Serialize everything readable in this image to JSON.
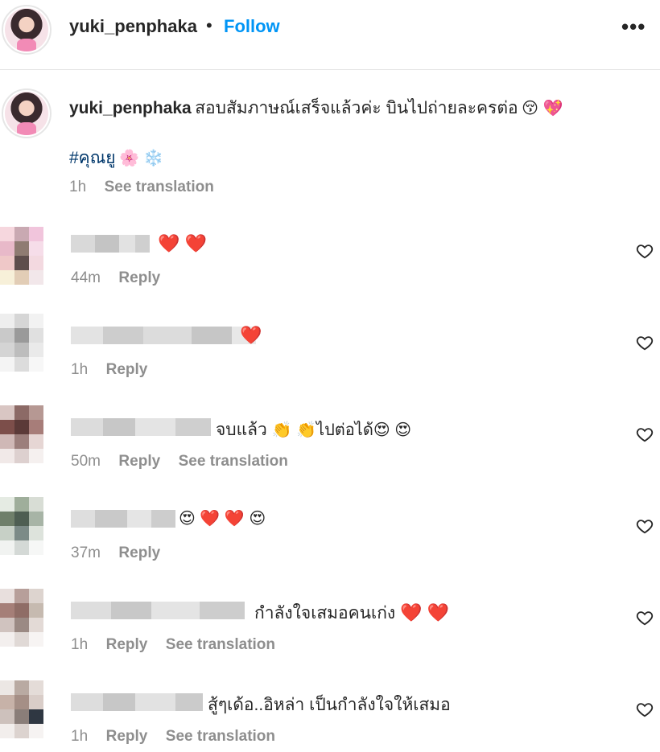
{
  "header": {
    "username": "yuki_penphaka",
    "separator": "•",
    "follow_label": "Follow",
    "more_icon": "•••"
  },
  "caption": {
    "username": "yuki_penphaka",
    "text": "สอบสัมภาษณ์เสร็จแล้วค่ะ บินไปถ่ายละครต่อ",
    "emojis": "😚 💖",
    "hashtag": "#คุณยู",
    "hashtag_emojis": "🌸 ❄️",
    "time": "1h",
    "see_translation": "See translation"
  },
  "comments": [
    {
      "text": "",
      "suffix": "❤️ ❤️",
      "time": "44m",
      "reply": "Reply",
      "see_translation": ""
    },
    {
      "text": "",
      "suffix": "❤️",
      "time": "1h",
      "reply": "Reply",
      "see_translation": ""
    },
    {
      "text": "จบแล้ว",
      "suffix": "👏 👏ไปต่อได้😍 😍",
      "time": "50m",
      "reply": "Reply",
      "see_translation": "See translation"
    },
    {
      "text": "",
      "suffix": "😍 ❤️ ❤️ 😍",
      "time": "37m",
      "reply": "Reply",
      "see_translation": ""
    },
    {
      "text": "กำลังใจเสมอคนเก่ง",
      "suffix": "❤️ ❤️",
      "time": "1h",
      "reply": "Reply",
      "see_translation": "See translation"
    },
    {
      "text": "สู้ๆเด้อ..อิหล่า เป็นกำลังใจให้เสมอ",
      "suffix": "",
      "time": "1h",
      "reply": "Reply",
      "see_translation": "See translation"
    }
  ],
  "colors": {
    "follow": "#0095f6",
    "meta": "#8e8e8e",
    "hashtag": "#00376b",
    "heart": "#ed1c3c"
  },
  "icons": {
    "comment_like": "heart-outline-icon",
    "more": "more-options-icon"
  }
}
